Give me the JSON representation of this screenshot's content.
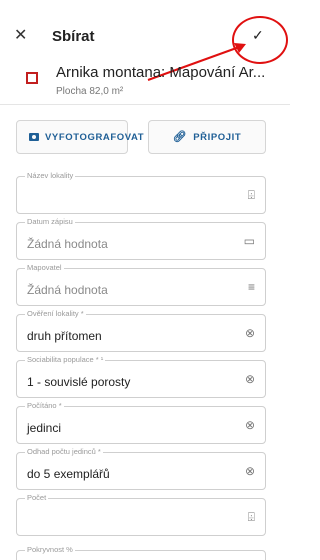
{
  "header": {
    "close_icon": "close-icon",
    "title": "Sbírat",
    "confirm_icon": "check-icon"
  },
  "feature": {
    "name": "Arnika montana: Mapování Ar...",
    "area": "Plocha 82,0 m²",
    "color": "#c21f1f"
  },
  "buttons": {
    "photo_label": "VYFOTOGRAFOVAT",
    "attach_label": "PŘIPOJIT"
  },
  "fields": [
    {
      "label": "Název lokality",
      "value": "",
      "placeholder": false,
      "icon": "barcode-scan-icon"
    },
    {
      "label": "Datum zápisu",
      "value": "Žádná hodnota",
      "placeholder": true,
      "icon": "calendar-icon"
    },
    {
      "label": "Mapovatel",
      "value": "Žádná hodnota",
      "placeholder": true,
      "icon": "list-icon"
    },
    {
      "label": "Ověření lokality *",
      "value": "druh přítomen",
      "placeholder": false,
      "icon": "clear-icon"
    },
    {
      "label": "Sociabilita populace * ¹",
      "value": "1 - souvislé porosty",
      "placeholder": false,
      "icon": "clear-icon"
    },
    {
      "label": "Počítáno *",
      "value": "jedinci",
      "placeholder": false,
      "icon": "clear-icon"
    },
    {
      "label": "Odhad počtu jedinců *",
      "value": "do 5 exemplářů",
      "placeholder": false,
      "icon": "clear-icon"
    },
    {
      "label": "Počet",
      "value": "",
      "placeholder": false,
      "icon": "barcode-scan-icon"
    },
    {
      "label": "Pokryvnost %",
      "value": "",
      "placeholder": false,
      "icon": ""
    }
  ],
  "colors": {
    "accent": "#1f5f96",
    "annotation": "#e01010"
  }
}
